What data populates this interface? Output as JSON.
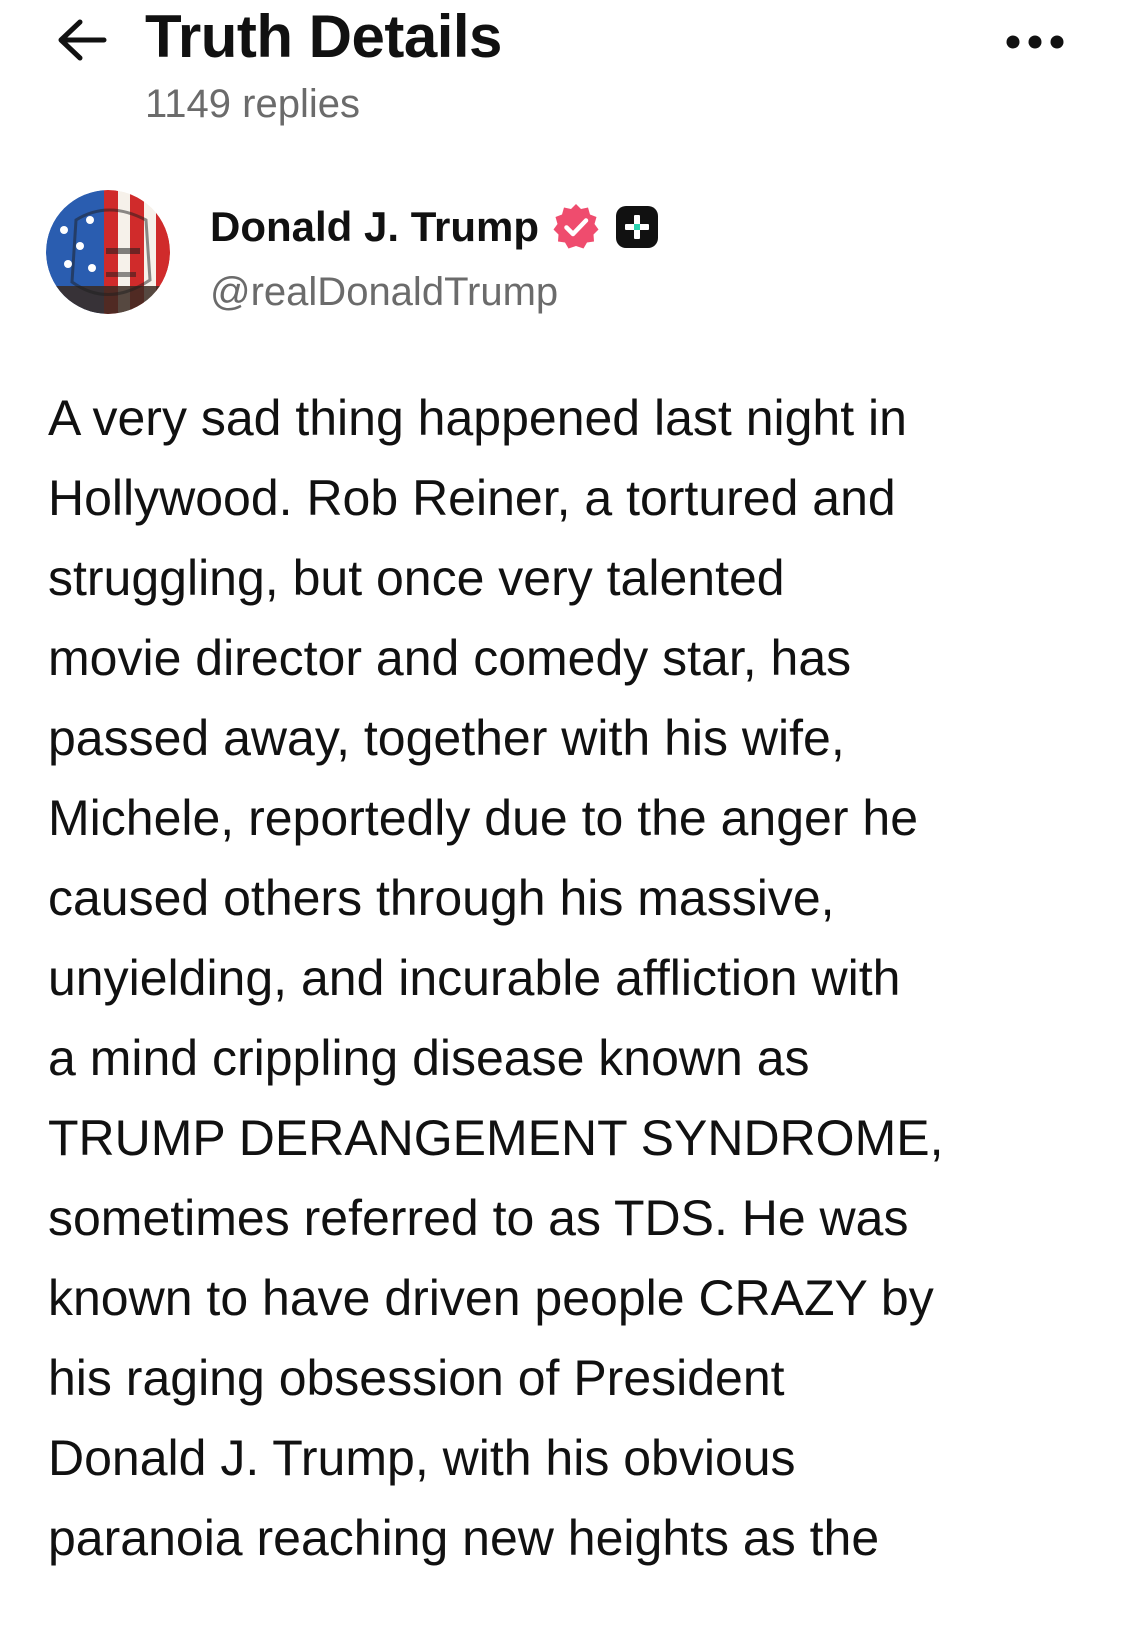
{
  "header": {
    "title": "Truth Details",
    "replies_label": "1149 replies",
    "back_icon": "arrow-left-icon",
    "more_icon": "more-horizontal-icon"
  },
  "author": {
    "display_name": "Donald J. Trump",
    "handle": "@realDonaldTrump",
    "verified_icon": "verified-badge-icon",
    "verified_color": "#ef4c6e",
    "plus_icon": "plus-badge-icon"
  },
  "post": {
    "text": "A very sad thing happened last night in\nHollywood. Rob Reiner, a tortured and\nstruggling, but once very talented\nmovie director and comedy star, has\npassed away, together with his wife,\nMichele, reportedly due to the anger he\ncaused others through his massive,\nunyielding, and incurable affliction with\na mind crippling disease known as\nTRUMP DERANGEMENT SYNDROME,\nsometimes referred to as TDS. He was\nknown to have driven people CRAZY by\nhis raging obsession of President\nDonald J. Trump, with his obvious\nparanoia reaching new heights as the"
  }
}
